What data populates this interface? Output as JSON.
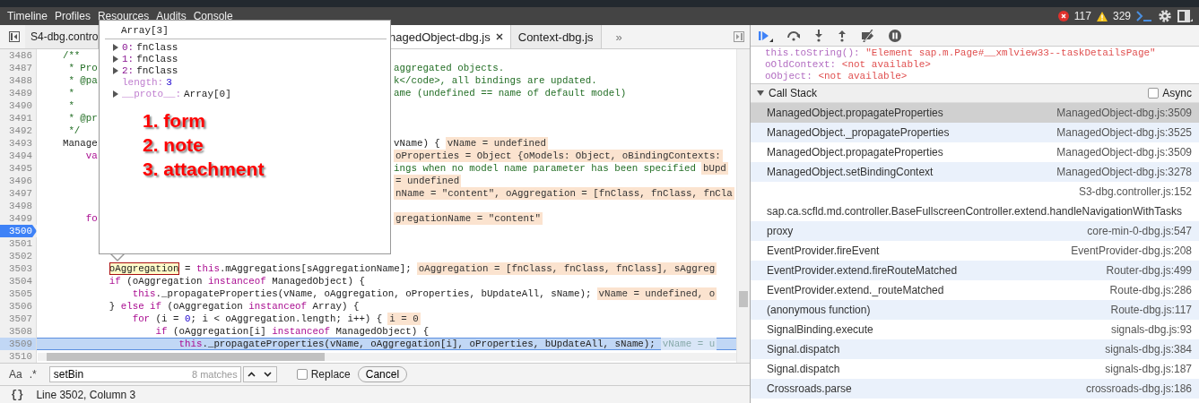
{
  "menu": {
    "tabs": [
      {
        "label": "Timeline"
      },
      {
        "label": "Profiles"
      },
      {
        "label": "Resources"
      },
      {
        "label": "Audits"
      },
      {
        "label": "Console"
      }
    ],
    "errors": "117",
    "warnings": "329"
  },
  "file_tabs": {
    "tabs": [
      {
        "label": "S4-dbg.contro",
        "selected": false,
        "closable": false
      },
      {
        "label": "nagedObject-dbg.js",
        "selected": true,
        "closable": true
      },
      {
        "label": "Context-dbg.js",
        "selected": false,
        "closable": false
      }
    ],
    "overflow": "»"
  },
  "code_lines": [
    {
      "number": "3486",
      "current": false,
      "breakpoint": false,
      "code": [
        {
          "kind": "comment",
          "text": "    /**"
        }
      ]
    },
    {
      "number": "3487",
      "current": false,
      "breakpoint": false,
      "code": [
        {
          "kind": "comment",
          "text": "     * Pro"
        }
      ],
      "after_popup": [
        {
          "kind": "comment",
          "text": "aggregated objects."
        }
      ]
    },
    {
      "number": "3488",
      "current": false,
      "breakpoint": false,
      "code": [
        {
          "kind": "comment",
          "text": "     * @pa"
        }
      ],
      "after_popup": [
        {
          "kind": "comment",
          "text": "k</code>, all bindings are updated."
        }
      ]
    },
    {
      "number": "3489",
      "current": false,
      "breakpoint": false,
      "code": [
        {
          "kind": "comment",
          "text": "     *"
        }
      ],
      "after_popup": [
        {
          "kind": "comment",
          "text": "ame (undefined == name of default model)"
        }
      ]
    },
    {
      "number": "3490",
      "current": false,
      "breakpoint": false,
      "code": [
        {
          "kind": "comment",
          "text": "     *"
        }
      ]
    },
    {
      "number": "3491",
      "current": false,
      "breakpoint": false,
      "code": [
        {
          "kind": "comment",
          "text": "     * @pr"
        }
      ]
    },
    {
      "number": "3492",
      "current": false,
      "breakpoint": false,
      "code": [
        {
          "kind": "comment",
          "text": "     */"
        }
      ]
    },
    {
      "number": "3493",
      "current": false,
      "breakpoint": false,
      "code": [
        {
          "kind": "code",
          "text": "    Manage"
        }
      ],
      "after_popup": [
        {
          "kind": "code",
          "text": "vName) {"
        },
        {
          "kind": "value",
          "text": "vName = undefined"
        }
      ]
    },
    {
      "number": "3494",
      "current": false,
      "breakpoint": false,
      "code": [
        {
          "kind": "keyword",
          "text": "        va"
        }
      ],
      "after_popup": [
        {
          "kind": "value",
          "text": "oProperties = Object {oModels: Object, oBindingContexts:"
        }
      ]
    },
    {
      "number": "3495",
      "current": false,
      "breakpoint": false,
      "after_popup": [
        {
          "kind": "comment",
          "text": "ings when no model name parameter has been specified"
        },
        {
          "kind": "value",
          "text": "bUpd"
        }
      ]
    },
    {
      "number": "3496",
      "current": false,
      "breakpoint": false,
      "after_popup": [
        {
          "kind": "value",
          "text": "= undefined"
        }
      ]
    },
    {
      "number": "3497",
      "current": false,
      "breakpoint": false,
      "after_popup": [
        {
          "kind": "value",
          "text": "nName = \"content\", oAggregation = [fnClass, fnClass, fnCla"
        }
      ]
    },
    {
      "number": "3498",
      "current": false,
      "breakpoint": false
    },
    {
      "number": "3499",
      "current": false,
      "breakpoint": false,
      "code": [
        {
          "kind": "keyword",
          "text": "        fo"
        }
      ],
      "after_popup": [
        {
          "kind": "value",
          "text": "gregationName = \"content\""
        }
      ]
    },
    {
      "number": "3500",
      "current": false,
      "breakpoint": true
    },
    {
      "number": "3501",
      "current": false,
      "breakpoint": false
    },
    {
      "number": "3502",
      "current": false,
      "breakpoint": false
    },
    {
      "number": "3503",
      "current": false,
      "breakpoint": false,
      "code": [
        {
          "kind": "hover",
          "text": "            oAggregation"
        },
        {
          "kind": "code",
          "text": " = "
        },
        {
          "kind": "keyword",
          "text": "this"
        },
        {
          "kind": "code",
          "text": ".mAggregations[sAggregationName];"
        },
        {
          "kind": "value",
          "text": "oAggregation = [fnClass, fnClass, fnClass], sAggreg"
        }
      ]
    },
    {
      "number": "3504",
      "current": false,
      "breakpoint": false,
      "code": [
        {
          "kind": "keyword",
          "text": "            if"
        },
        {
          "kind": "code",
          "text": " (oAggregation "
        },
        {
          "kind": "keyword",
          "text": "instanceof"
        },
        {
          "kind": "code",
          "text": " ManagedObject) {"
        }
      ]
    },
    {
      "number": "3505",
      "current": false,
      "breakpoint": false,
      "code": [
        {
          "kind": "keyword",
          "text": "                this"
        },
        {
          "kind": "code",
          "text": "._propagateProperties(vName, oAggregation, oProperties, bUpdateAll, sName);"
        },
        {
          "kind": "value",
          "text": "vName = undefined, o"
        }
      ]
    },
    {
      "number": "3506",
      "current": false,
      "breakpoint": false,
      "code": [
        {
          "kind": "code",
          "text": "            } "
        },
        {
          "kind": "keyword",
          "text": "else if"
        },
        {
          "kind": "code",
          "text": " (oAggregation "
        },
        {
          "kind": "keyword",
          "text": "instanceof"
        },
        {
          "kind": "code",
          "text": " Array) {"
        }
      ]
    },
    {
      "number": "3507",
      "current": false,
      "breakpoint": false,
      "code": [
        {
          "kind": "keyword",
          "text": "                for"
        },
        {
          "kind": "code",
          "text": " (i = "
        },
        {
          "kind": "number",
          "text": "0"
        },
        {
          "kind": "code",
          "text": "; i < oAggregation.length; i++) {"
        },
        {
          "kind": "value",
          "text": "i = 0"
        }
      ]
    },
    {
      "number": "3508",
      "current": false,
      "breakpoint": false,
      "code": [
        {
          "kind": "keyword",
          "text": "                    if"
        },
        {
          "kind": "code",
          "text": " (oAggregation[i] "
        },
        {
          "kind": "keyword",
          "text": "instanceof"
        },
        {
          "kind": "code",
          "text": " ManagedObject) {"
        }
      ]
    },
    {
      "number": "3509",
      "current": true,
      "breakpoint": false,
      "code": [
        {
          "kind": "keyword",
          "text": "                        this"
        },
        {
          "kind": "code",
          "text": "._propagateProperties(vName, oAggregation[i], oProperties, bUpdateAll, sName);"
        },
        {
          "kind": "value",
          "text": "vName = u"
        }
      ]
    },
    {
      "number": "3510",
      "current": false,
      "breakpoint": false
    }
  ],
  "popover": {
    "title": "Array[3]",
    "items": [
      {
        "key": "0:",
        "value": "fnClass",
        "kind": "index",
        "expandable": true
      },
      {
        "key": "1:",
        "value": "fnClass",
        "kind": "index",
        "expandable": true
      },
      {
        "key": "2:",
        "value": "fnClass",
        "kind": "index",
        "expandable": true
      },
      {
        "key": "length:",
        "value": "3",
        "kind": "internal",
        "expandable": false
      },
      {
        "key": "__proto__:",
        "value": "Array[0]",
        "kind": "internal",
        "expandable": true
      }
    ],
    "notes": [
      "1. form",
      "2. note",
      "3. attachment"
    ]
  },
  "search_bar": {
    "case_toggle": "Aa",
    "regex_toggle": ".*",
    "value": "setBin",
    "matches": "8 matches",
    "replace": {
      "label": "Replace",
      "checked": false
    },
    "cancel": "Cancel"
  },
  "status_bar": {
    "format_button": "{}",
    "position": "Line 3502, Column 3"
  },
  "scope": [
    {
      "name": "this.toString():",
      "value": "\"Element sap.m.Page#__xmlview33--taskDetailsPage\""
    },
    {
      "name": "oOldContext:",
      "value": "<not available>"
    },
    {
      "name": "oObject:",
      "value": "<not available>"
    }
  ],
  "call_stack": {
    "title": "Call Stack",
    "expanded": true,
    "async": {
      "label": "Async",
      "checked": false
    },
    "frames": [
      {
        "function": "ManagedObject.propagateProperties",
        "location": "ManagedObject-dbg.js:3509",
        "selected": true
      },
      {
        "function": "ManagedObject._propagateProperties",
        "location": "ManagedObject-dbg.js:3525",
        "selected": false
      },
      {
        "function": "ManagedObject.propagateProperties",
        "location": "ManagedObject-dbg.js:3509",
        "selected": false
      },
      {
        "function": "ManagedObject.setBindingContext",
        "location": "ManagedObject-dbg.js:3278",
        "selected": false
      },
      {
        "function": "sap.ca.scfld.md.controller.BaseFullscreenController.extend.handleNavigationWithTasks",
        "location": "S3-dbg.controller.js:152",
        "selected": false
      },
      {
        "function": "proxy",
        "location": "core-min-0-dbg.js:547",
        "selected": false
      },
      {
        "function": "EventProvider.fireEvent",
        "location": "EventProvider-dbg.js:208",
        "selected": false
      },
      {
        "function": "EventProvider.extend.fireRouteMatched",
        "location": "Router-dbg.js:499",
        "selected": false
      },
      {
        "function": "EventProvider.extend._routeMatched",
        "location": "Route-dbg.js:286",
        "selected": false
      },
      {
        "function": "(anonymous function)",
        "location": "Route-dbg.js:117",
        "selected": false
      },
      {
        "function": "SignalBinding.execute",
        "location": "signals-dbg.js:93",
        "selected": false
      },
      {
        "function": "Signal.dispatch",
        "location": "signals-dbg.js:384",
        "selected": false
      },
      {
        "function": "Signal.dispatch",
        "location": "signals-dbg.js:187",
        "selected": false
      },
      {
        "function": "Crossroads.parse",
        "location": "crossroads-dbg.js:186",
        "selected": false
      }
    ]
  }
}
